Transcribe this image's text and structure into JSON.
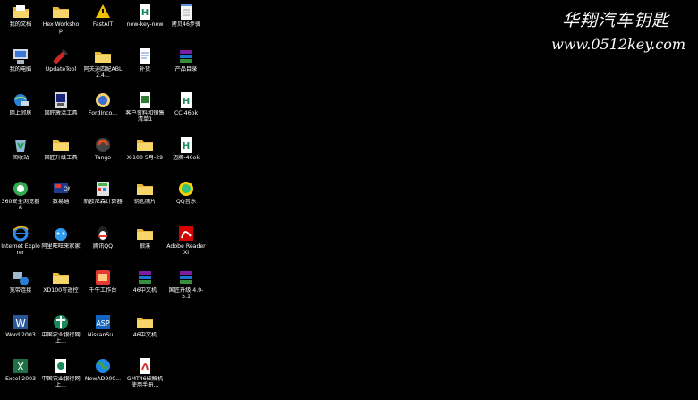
{
  "brand": {
    "title": "华翔汽车钥匙",
    "url": "www.0512key.com"
  },
  "columns": [
    {
      "items": [
        {
          "label": "我的文档",
          "icon": "my-documents-icon"
        },
        {
          "label": "我的电脑",
          "icon": "my-computer-icon"
        },
        {
          "label": "网上邻居",
          "icon": "network-places-icon"
        },
        {
          "label": "回收站",
          "icon": "recycle-bin-icon"
        },
        {
          "label": "360安全浏览器6",
          "icon": "browser-360-icon"
        },
        {
          "label": "Internet Explorer",
          "icon": "internet-explorer-icon"
        },
        {
          "label": "宽带连接",
          "icon": "broadband-connection-icon"
        },
        {
          "label": "Word 2003",
          "icon": "word-icon"
        },
        {
          "label": "Excel 2003",
          "icon": "excel-icon"
        }
      ]
    },
    {
      "items": [
        {
          "label": "Hex Workshop",
          "icon": "folder-icon"
        },
        {
          "label": "UpdateTool",
          "icon": "update-tool-icon"
        },
        {
          "label": "国匠激活工具",
          "icon": "activation-tool-icon"
        },
        {
          "label": "国匠升级工具",
          "icon": "folder-icon"
        },
        {
          "label": "数易通",
          "icon": "shuyitong-icon"
        },
        {
          "label": "阿里旺旺来家家",
          "icon": "aliwangwang-icon"
        },
        {
          "label": "XD100写遥控",
          "icon": "folder-icon"
        },
        {
          "label": "中国农业银行网上...",
          "icon": "abc-bank-icon"
        },
        {
          "label": "中国农业银行网上...",
          "icon": "abc-bank-doc-icon"
        }
      ]
    },
    {
      "items": [
        {
          "label": "FastAIT",
          "icon": "fastait-icon"
        },
        {
          "label": "阿夫迪四配ABL 2.4...",
          "icon": "folder-icon"
        },
        {
          "label": "FordInco...",
          "icon": "ford-icon"
        },
        {
          "label": "Tango",
          "icon": "tango-icon"
        },
        {
          "label": "新欧尼森计算器",
          "icon": "calculator-icon"
        },
        {
          "label": "腾讯QQ",
          "icon": "qq-icon"
        },
        {
          "label": "千牛工作台",
          "icon": "qianniu-icon"
        },
        {
          "label": "NissanSu...",
          "icon": "nissan-icon"
        },
        {
          "label": "NewAD900...",
          "icon": "globe-icon"
        }
      ]
    },
    {
      "items": [
        {
          "label": "new-key-new",
          "icon": "key-doc-icon"
        },
        {
          "label": "补货",
          "icon": "document-icon"
        },
        {
          "label": "客户资料和销售清单1",
          "icon": "spreadsheet-icon"
        },
        {
          "label": "X-100 5月-29",
          "icon": "folder-icon"
        },
        {
          "label": "钥匙照片",
          "icon": "folder-icon"
        },
        {
          "label": "狼溪",
          "icon": "folder-icon"
        },
        {
          "label": "46中文机",
          "icon": "winrar-icon"
        },
        {
          "label": "46中文机",
          "icon": "folder-icon"
        },
        {
          "label": "GMT46破解机使用手册...",
          "icon": "pdf-icon"
        }
      ]
    },
    {
      "items": [
        {
          "label": "拷贝46步骤",
          "icon": "notepad-icon"
        },
        {
          "label": "产品目录",
          "icon": "winrar-icon"
        },
        {
          "label": "CC-46ok",
          "icon": "key-doc-icon"
        },
        {
          "label": "迈腾-46ok",
          "icon": "key-doc-icon"
        },
        {
          "label": "QQ音乐",
          "icon": "qq-music-icon"
        },
        {
          "label": "Adobe Reader XI",
          "icon": "adobe-reader-icon"
        },
        {
          "label": "国匠升级 4.9-5.1",
          "icon": "winrar-icon"
        }
      ]
    }
  ],
  "colors": {
    "background": "#000000",
    "text": "#ffffff",
    "folder": "#f2c94c"
  }
}
